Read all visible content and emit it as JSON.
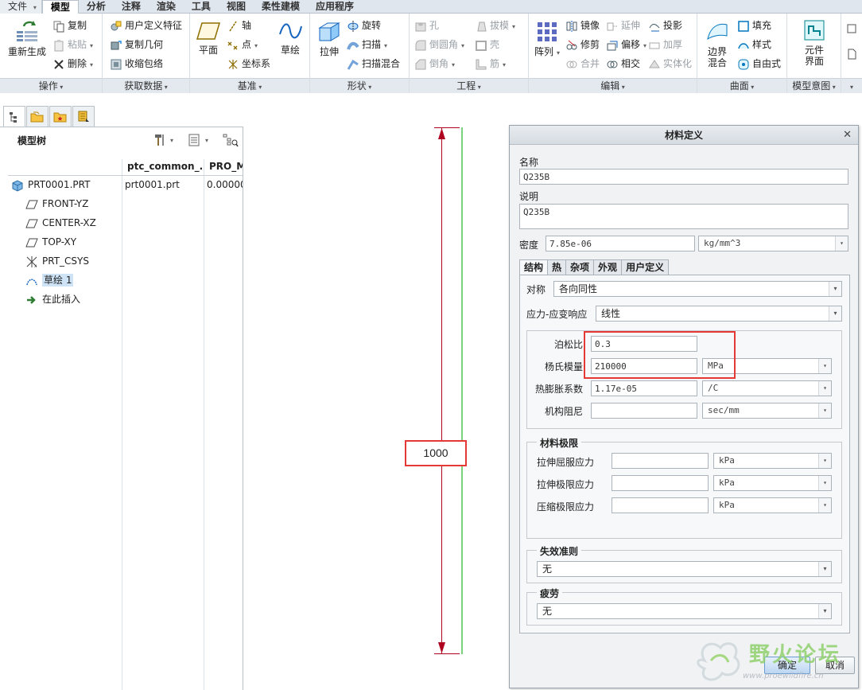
{
  "menu": {
    "file": "文件",
    "tabs": [
      "模型",
      "分析",
      "注释",
      "渲染",
      "工具",
      "视图",
      "柔性建模",
      "应用程序"
    ],
    "active": "模型"
  },
  "ribbon": {
    "ops": {
      "regen": "重新生成",
      "copy": "复制",
      "paste": "粘贴",
      "delete": "删除",
      "label": "操作"
    },
    "get": {
      "udf": "用户定义特征",
      "copygeom": "复制几何",
      "shrink": "收缩包络",
      "label": "获取数据"
    },
    "datum": {
      "plane": "平面",
      "axis": "轴",
      "point": "点",
      "csys": "坐标系",
      "sketch": "草绘",
      "label": "基准"
    },
    "shape": {
      "extrude": "拉伸",
      "revolve": "旋转",
      "sweep": "扫描",
      "sweepblend": "扫描混合",
      "label": "形状"
    },
    "eng": {
      "hole": "孔",
      "round": "倒圆角",
      "chamfer": "倒角",
      "draft": "拔模",
      "shell": "壳",
      "rib": "筋",
      "label": "工程"
    },
    "edit": {
      "pattern": "阵列",
      "mirror": "镜像",
      "trim": "修剪",
      "merge": "合并",
      "extend": "延伸",
      "offset": "偏移",
      "intersect": "相交",
      "project": "投影",
      "thicken": "加厚",
      "solidify": "实体化",
      "label": "编辑"
    },
    "surface": {
      "boundary": "边界\n混合",
      "fill": "填充",
      "style": "样式",
      "freestyle": "自由式",
      "label": "曲面"
    },
    "intent": {
      "component": "元件\n界面",
      "label": "模型意图"
    }
  },
  "modeltree": {
    "title": "模型树",
    "columns": [
      "ptc_common_...",
      "PRO_M"
    ],
    "rows": [
      {
        "name": "PRT0001.PRT",
        "col1": "prt0001.prt",
        "col2": "0.00000",
        "icon": "part-icon"
      },
      {
        "name": "FRONT-YZ",
        "icon": "plane-icon"
      },
      {
        "name": "CENTER-XZ",
        "icon": "plane-icon"
      },
      {
        "name": "TOP-XY",
        "icon": "plane-icon"
      },
      {
        "name": "PRT_CSYS",
        "icon": "csys-icon"
      },
      {
        "name": "草绘 1",
        "icon": "sketch-icon"
      },
      {
        "name": "在此插入",
        "icon": "insert-arrow-icon"
      }
    ]
  },
  "graphics": {
    "dimension": "1000"
  },
  "dialog": {
    "title": "材料定义",
    "name_label": "名称",
    "name_value": "Q235B",
    "desc_label": "说明",
    "desc_value": "Q235B",
    "density_label": "密度",
    "density_value": "7.85e-06",
    "density_unit": "kg/mm^3",
    "tabs": [
      "结构",
      "热",
      "杂项",
      "外观",
      "用户定义"
    ],
    "symmetry_label": "对称",
    "symmetry_value": "各向同性",
    "response_label": "应力-应变响应",
    "response_value": "线性",
    "poisson_label": "泊松比",
    "poisson_value": "0.3",
    "young_label": "杨氏模量",
    "young_value": "210000",
    "young_unit": "MPa",
    "thermal_label": "热膨胀系数",
    "thermal_value": "1.17e-05",
    "thermal_unit": "/C",
    "damping_label": "机构阻尼",
    "damping_value": "",
    "damping_unit": "sec/mm",
    "limits_title": "材料极限",
    "tensile_yield_label": "拉伸屈服应力",
    "tensile_ult_label": "拉伸极限应力",
    "compress_label": "压缩极限应力",
    "kpa": "kPa",
    "failure_title": "失效准则",
    "failure_value": "无",
    "fatigue_title": "疲劳",
    "fatigue_value": "无",
    "ok": "确定",
    "cancel": "取消"
  },
  "watermark": {
    "text": "野火论坛",
    "url": "www.proewildfire.cn"
  },
  "colors": {
    "highlight": "#e53935",
    "dimension": "#b00020",
    "sketch": "#7bd37b",
    "selection": "#cfe3f7"
  }
}
